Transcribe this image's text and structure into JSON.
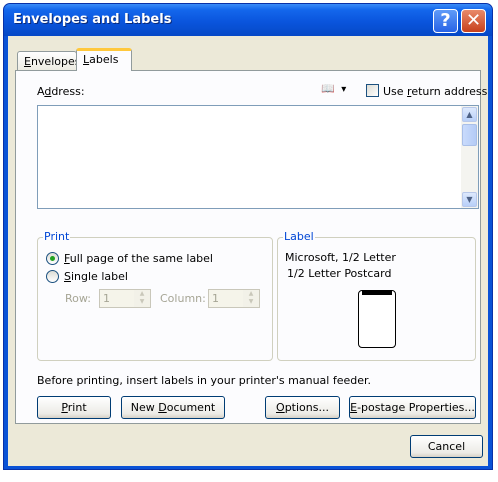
{
  "window": {
    "title": "Envelopes and Labels",
    "help_glyph": "?",
    "close_glyph": "✕"
  },
  "tabs": {
    "envelopes": {
      "pre": "",
      "ul": "E",
      "post": "nvelopes"
    },
    "labels": {
      "pre": "",
      "ul": "L",
      "post": "abels"
    },
    "active": "labels"
  },
  "address": {
    "label_pre": "A",
    "label_ul": "d",
    "label_post": "dress:",
    "value": "",
    "address_book_glyph": "📖",
    "dropdown_glyph": "▾",
    "use_return_address": {
      "pre": "Use ",
      "ul": "r",
      "post": "eturn address",
      "checked": false
    }
  },
  "print_group": {
    "title": "Print",
    "full_page": {
      "pre": "",
      "ul": "F",
      "post": "ull page of the same label",
      "checked": true
    },
    "single_label": {
      "pre": "",
      "ul": "S",
      "post": "ingle label",
      "checked": false
    },
    "row": {
      "label": "Row:",
      "value": "1"
    },
    "column": {
      "label": "Column:",
      "value": "1"
    }
  },
  "label_group": {
    "title": "Label",
    "vendor_line": "Microsoft,  1/2 Letter",
    "product_line": "1/2 Letter Postcard"
  },
  "instruction": "Before printing, insert labels in your printer's manual feeder.",
  "buttons": {
    "print": {
      "pre": "",
      "ul": "P",
      "post": "rint"
    },
    "new_document": {
      "pre": "New ",
      "ul": "D",
      "post": "ocument"
    },
    "options": {
      "pre": "",
      "ul": "O",
      "post": "ptions..."
    },
    "epostage": {
      "pre": "",
      "ul": "E",
      "post": "-postage Properties..."
    },
    "cancel": {
      "pre": "Cancel",
      "ul": "",
      "post": ""
    }
  },
  "scroll_glyphs": {
    "up": "▲",
    "down": "▼"
  },
  "colors": {
    "titlebar": "#0a55dd",
    "dialog_bg": "#ece9d8",
    "group_title": "#0046d5",
    "active_tab_accent": "#ffc83c"
  }
}
